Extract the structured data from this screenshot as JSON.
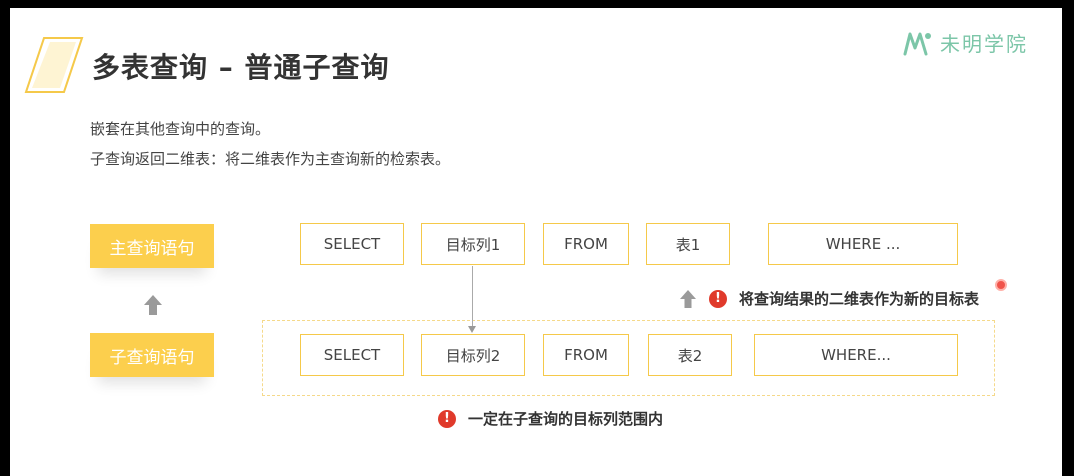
{
  "slide": {
    "title": "多表查询 – 普通子查询",
    "logo_text": "未明学院",
    "desc_line1": "嵌套在其他查询中的查询。",
    "desc_line2": "子查询返回二维表：将二维表作为主查询新的检索表。"
  },
  "labels": {
    "main_query": "主查询语句",
    "sub_query": "子查询语句"
  },
  "row1": [
    "SELECT",
    "目标列1",
    "FROM",
    "表1",
    "WHERE ..."
  ],
  "row2": [
    "SELECT",
    "目标列2",
    "FROM",
    "表2",
    "WHERE..."
  ],
  "notes": {
    "note1": "将查询结果的二维表作为新的目标表",
    "note2": "一定在子查询的目标列范围内",
    "excl": "!"
  },
  "colors": {
    "accent": "#fccf4d",
    "border": "#f5c94a",
    "alert": "#e03a2b",
    "logo": "#7cc6a8"
  }
}
